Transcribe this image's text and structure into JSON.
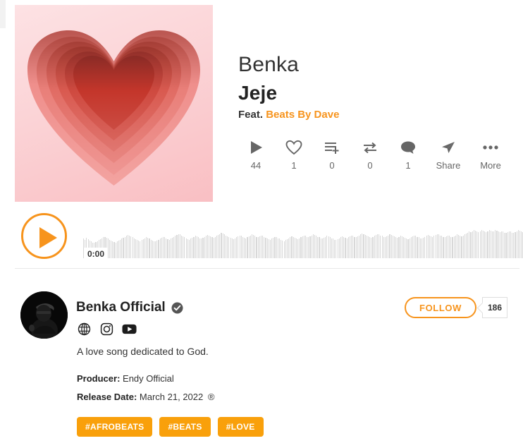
{
  "track": {
    "artist": "Benka",
    "title": "Jeje",
    "feat_prefix": "Feat.",
    "feat_artist": "Beats By Dave",
    "artwork_alt": "layered-paper-heart-artwork"
  },
  "actions": [
    {
      "icon": "play-icon",
      "name": "plays",
      "label": "44"
    },
    {
      "icon": "heart-icon",
      "name": "likes",
      "label": "1"
    },
    {
      "icon": "playlist-add-icon",
      "name": "add-to-playlist",
      "label": "0"
    },
    {
      "icon": "repost-icon",
      "name": "reposts",
      "label": "0"
    },
    {
      "icon": "comment-icon",
      "name": "comments",
      "label": "1"
    },
    {
      "icon": "share-icon",
      "name": "share",
      "label": "Share"
    },
    {
      "icon": "more-icon",
      "name": "more",
      "label": "More"
    }
  ],
  "player": {
    "play_button": "play-button",
    "current_time": "0:00",
    "waveform": [
      42,
      40,
      44,
      41,
      38,
      36,
      34,
      33,
      35,
      37,
      39,
      41,
      43,
      45,
      46,
      44,
      42,
      40,
      38,
      36,
      35,
      34,
      36,
      38,
      40,
      42,
      44,
      46,
      48,
      50,
      49,
      47,
      45,
      43,
      41,
      39,
      38,
      37,
      39,
      41,
      43,
      45,
      44,
      42,
      40,
      38,
      37,
      36,
      38,
      40,
      42,
      44,
      46,
      45,
      43,
      41,
      40,
      42,
      44,
      46,
      48,
      50,
      52,
      51,
      49,
      47,
      45,
      43,
      41,
      40,
      42,
      44,
      46,
      48,
      47,
      45,
      43,
      42,
      44,
      46,
      48,
      50,
      49,
      47,
      45,
      44,
      46,
      48,
      50,
      52,
      54,
      53,
      51,
      49,
      47,
      46,
      44,
      42,
      41,
      43,
      45,
      47,
      49,
      48,
      46,
      44,
      43,
      45,
      47,
      49,
      51,
      50,
      48,
      46,
      45,
      47,
      49,
      48,
      46,
      44,
      43,
      41,
      40,
      42,
      44,
      46,
      45,
      43,
      42,
      40,
      38,
      37,
      39,
      41,
      43,
      45,
      47,
      46,
      44,
      42,
      41,
      43,
      45,
      47,
      49,
      48,
      46,
      45,
      47,
      49,
      51,
      50,
      48,
      46,
      45,
      43,
      42,
      44,
      46,
      48,
      47,
      45,
      43,
      42,
      40,
      39,
      41,
      43,
      45,
      47,
      46,
      44,
      43,
      45,
      47,
      49,
      48,
      46,
      45,
      47,
      49,
      51,
      53,
      52,
      50,
      48,
      47,
      45,
      44,
      46,
      48,
      50,
      52,
      51,
      49,
      48,
      46,
      45,
      47,
      49,
      51,
      50,
      48,
      47,
      45,
      44,
      46,
      48,
      47,
      45,
      44,
      42,
      41,
      43,
      45,
      47,
      49,
      48,
      46,
      45,
      43,
      42,
      44,
      46,
      48,
      50,
      49,
      47,
      46,
      48,
      50,
      52,
      51,
      49,
      48,
      46,
      45,
      47,
      49,
      48,
      46,
      45,
      47,
      49,
      51,
      50,
      48,
      47,
      49,
      51,
      53,
      55,
      57,
      56,
      58,
      60,
      59,
      57,
      56,
      58,
      60,
      59,
      57,
      56,
      58,
      60,
      59,
      57,
      58,
      60,
      59,
      57,
      56,
      58,
      57,
      55,
      54,
      56,
      58,
      57,
      55,
      54,
      56,
      58,
      60,
      59,
      57,
      56
    ]
  },
  "artist": {
    "name": "Benka Official",
    "verified_icon": "verified-badge-icon",
    "avatar": "artist-avatar",
    "socials": [
      {
        "icon": "globe-icon",
        "name": "website"
      },
      {
        "icon": "instagram-icon",
        "name": "instagram"
      },
      {
        "icon": "youtube-icon",
        "name": "youtube"
      }
    ],
    "follow_label": "FOLLOW",
    "follower_count": "186"
  },
  "details": {
    "description": "A love song dedicated to God.",
    "producer_label": "Producer:",
    "producer_value": "Endy Official",
    "release_label": "Release Date:",
    "release_value": "March 21, 2022",
    "rights_mark": "®"
  },
  "tags": [
    "#AFROBEATS",
    "#BEATS",
    "#LOVE"
  ],
  "colors": {
    "accent": "#f7941d",
    "tag_bg": "#f9a00b",
    "waveform": "#d8d8d8",
    "artwork_bg": "#fbd3d6",
    "artwork_core": "#c4362b"
  }
}
